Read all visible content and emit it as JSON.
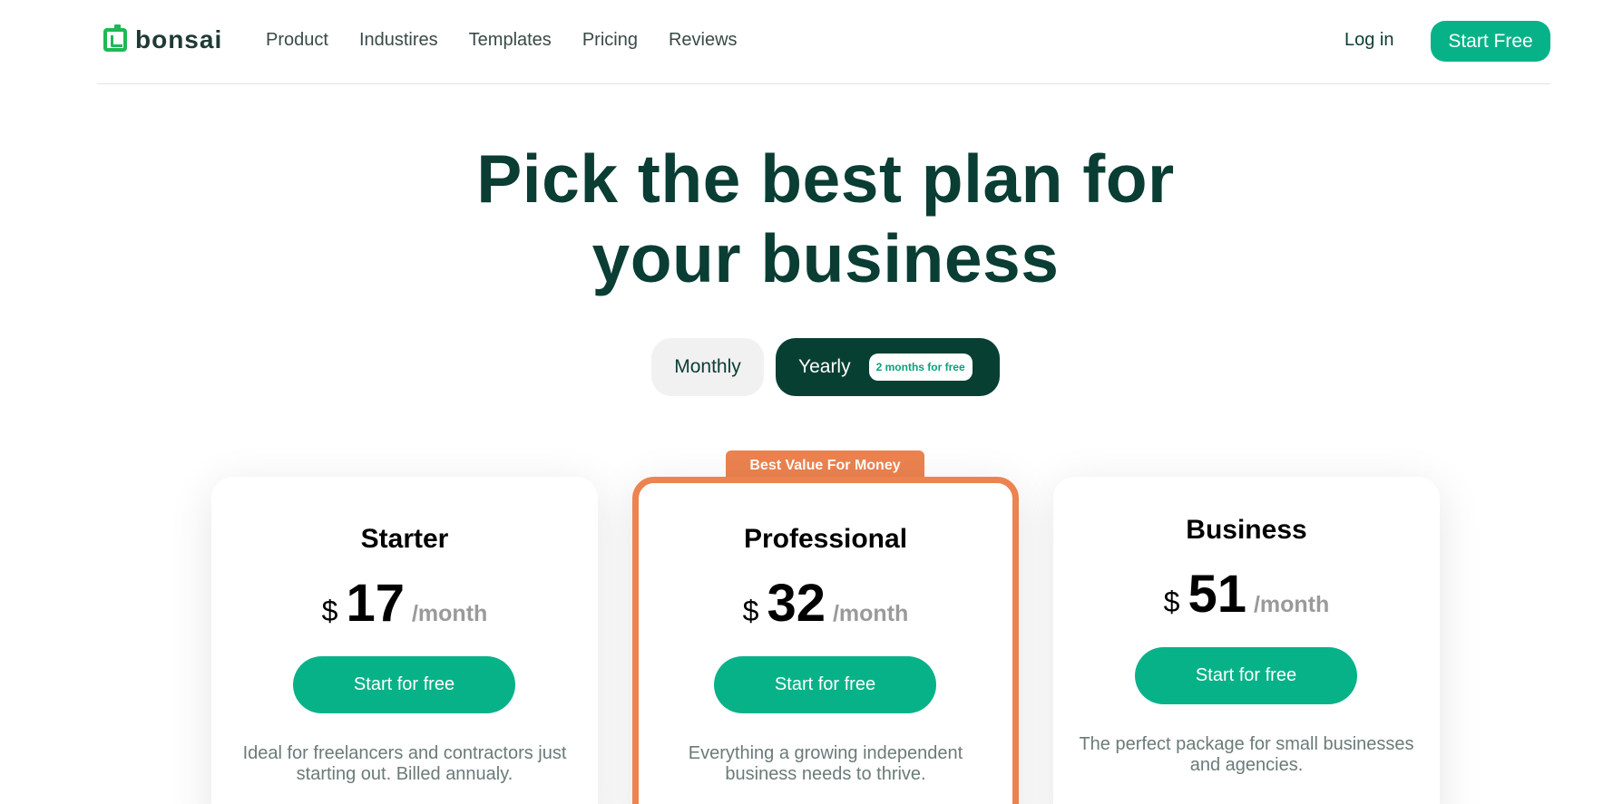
{
  "brand": {
    "name": "bonsai"
  },
  "nav": {
    "items": [
      {
        "label": "Product"
      },
      {
        "label": "Industires"
      },
      {
        "label": "Templates"
      },
      {
        "label": "Pricing"
      },
      {
        "label": "Reviews"
      }
    ],
    "login_label": "Log in",
    "start_label": "Start Free"
  },
  "hero": {
    "title_line1": "Pick the best plan for",
    "title_line2": "your business"
  },
  "billing_toggle": {
    "monthly_label": "Monthly",
    "yearly_label": "Yearly",
    "yearly_badge": "2 months for free",
    "selected": "Yearly"
  },
  "plans": [
    {
      "name": "Starter",
      "currency": "$",
      "price": "17",
      "period": "/month",
      "cta": "Start for free",
      "description": "Ideal for freelancers and contractors just starting out. Billed annualy."
    },
    {
      "name": "Professional",
      "ribbon": "Best Value For Money",
      "currency": "$",
      "price": "32",
      "period": "/month",
      "cta": "Start for free",
      "description": "Everything a growing independent business needs to thrive."
    },
    {
      "name": "Business",
      "currency": "$",
      "price": "51",
      "period": "/month",
      "cta": "Start for free",
      "description": "The perfect package for small businesses and agencies."
    }
  ],
  "colors": {
    "brand_green": "#08b288",
    "dark_green": "#083f33",
    "accent_orange": "#ec8350",
    "logo_green": "#1db954"
  }
}
